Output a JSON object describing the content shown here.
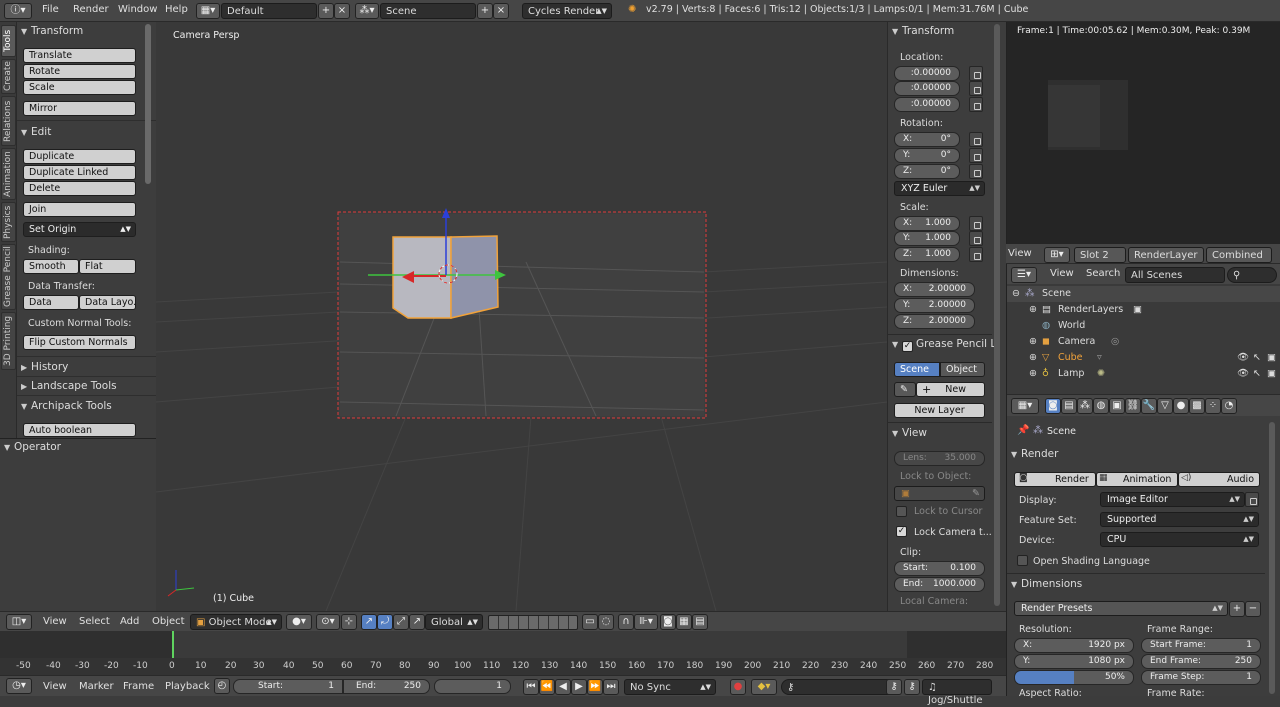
{
  "topbar": {
    "menus": [
      "File",
      "Render",
      "Window",
      "Help"
    ],
    "layout_screen": "Default",
    "scene": "Scene",
    "engine": "Cycles Render",
    "stats": "v2.79 | Verts:8 | Faces:6 | Tris:12 | Objects:1/3 | Lamps:0/1 | Mem:31.76M | Cube"
  },
  "tool_tabs": [
    "Tools",
    "Create",
    "Relations",
    "Animation",
    "Physics",
    "Grease Pencil",
    "3D Printing"
  ],
  "toolshelf": {
    "transform": {
      "title": "Transform",
      "buttons": [
        "Translate",
        "Rotate",
        "Scale",
        "Mirror"
      ]
    },
    "edit": {
      "title": "Edit",
      "buttons": [
        "Duplicate",
        "Duplicate Linked",
        "Delete",
        "Join"
      ],
      "set_origin": "Set Origin",
      "shading_label": "Shading:",
      "smooth": "Smooth",
      "flat": "Flat",
      "data_transfer_label": "Data Transfer:",
      "data": "Data",
      "data_layout": "Data Layo...",
      "custom_normal_label": "Custom Normal Tools:",
      "flip_normals": "Flip Custom Normals"
    },
    "history": "History",
    "landscape": "Landscape Tools",
    "archipack": "Archipack Tools",
    "auto_boolean": "Auto boolean"
  },
  "operator": {
    "title": "Operator"
  },
  "viewport": {
    "label": "Camera Persp",
    "object_label": "(1) Cube"
  },
  "npanel": {
    "transform_title": "Transform",
    "location_label": "Location:",
    "location": [
      ":0.00000",
      ":0.00000",
      ":0.00000"
    ],
    "rotation_label": "Rotation:",
    "rotation": [
      {
        "k": "X:",
        "v": "0°"
      },
      {
        "k": "Y:",
        "v": "0°"
      },
      {
        "k": "Z:",
        "v": "0°"
      }
    ],
    "rotation_mode": "XYZ Euler",
    "scale_label": "Scale:",
    "scale": [
      {
        "k": "X:",
        "v": "1.000"
      },
      {
        "k": "Y:",
        "v": "1.000"
      },
      {
        "k": "Z:",
        "v": "1.000"
      }
    ],
    "dimensions_label": "Dimensions:",
    "dimensions": [
      {
        "k": "X:",
        "v": "2.00000"
      },
      {
        "k": "Y:",
        "v": "2.00000"
      },
      {
        "k": "Z:",
        "v": "2.00000"
      }
    ],
    "grease_pencil_title": "Grease Pencil L",
    "gp_scene": "Scene",
    "gp_object": "Object",
    "gp_new": "New",
    "gp_new_layer": "New Layer",
    "view_title": "View",
    "lens_label": "Lens:",
    "lens_value": "35.000",
    "lock_to_object": "Lock to Object:",
    "lock_to_cursor": "Lock to Cursor",
    "lock_camera": "Lock Camera t...",
    "clip_label": "Clip:",
    "clip_start_label": "Start:",
    "clip_start": "0.100",
    "clip_end_label": "End:",
    "clip_end": "1000.000",
    "local_camera": "Local Camera:"
  },
  "render_view": {
    "info": "Frame:1 | Time:00:05.62 | Mem:0.30M, Peak: 0.39M"
  },
  "image_header": {
    "view": "View",
    "slot": "Slot 2",
    "layer": "RenderLayer",
    "pass": "Combined"
  },
  "outliner": {
    "view": "View",
    "search": "Search",
    "filter": "All Scenes",
    "items": [
      {
        "name": "Scene",
        "indent": 0
      },
      {
        "name": "RenderLayers",
        "indent": 1
      },
      {
        "name": "World",
        "indent": 1
      },
      {
        "name": "Camera",
        "indent": 1
      },
      {
        "name": "Cube",
        "indent": 1
      },
      {
        "name": "Lamp",
        "indent": 1
      }
    ]
  },
  "props": {
    "scene": "Scene",
    "render_title": "Render",
    "render_btn": "Render",
    "animation_btn": "Animation",
    "audio_btn": "Audio",
    "display_label": "Display:",
    "display_value": "Image Editor",
    "feature_label": "Feature Set:",
    "feature_value": "Supported",
    "device_label": "Device:",
    "device_value": "CPU",
    "osl": "Open Shading Language",
    "dimensions_title": "Dimensions",
    "render_presets": "Render Presets",
    "resolution_label": "Resolution:",
    "res_x_label": "X:",
    "res_x": "1920 px",
    "res_y_label": "Y:",
    "res_y": "1080 px",
    "res_pct": "50%",
    "frame_range_label": "Frame Range:",
    "start_frame_label": "Start Frame:",
    "start_frame": "1",
    "end_frame_label": "End Frame:",
    "end_frame": "250",
    "frame_step_label": "Frame Step:",
    "frame_step": "1",
    "aspect_ratio": "Aspect Ratio:",
    "frame_rate": "Frame Rate:"
  },
  "view3d_header": {
    "menus": [
      "View",
      "Select",
      "Add",
      "Object"
    ],
    "mode": "Object Mode",
    "orientation": "Global"
  },
  "timeline": {
    "ticks": [
      "-50",
      "-40",
      "-30",
      "-20",
      "-10",
      "0",
      "10",
      "20",
      "30",
      "40",
      "50",
      "60",
      "70",
      "80",
      "90",
      "100",
      "110",
      "120",
      "130",
      "140",
      "150",
      "160",
      "170",
      "180",
      "190",
      "200",
      "210",
      "220",
      "230",
      "240",
      "250",
      "260",
      "270",
      "280"
    ],
    "menus": [
      "View",
      "Marker",
      "Frame",
      "Playback"
    ],
    "start_label": "Start:",
    "start": "1",
    "end_label": "End:",
    "end": "250",
    "current": "1",
    "sync": "No Sync",
    "keying": "Jog/Shuttle"
  },
  "colors": {
    "accent": "#5680c2",
    "selection": "#f1a23a",
    "x_axis": "#d72828",
    "y_axis": "#3ec43e",
    "z_axis": "#2b3fd9"
  }
}
